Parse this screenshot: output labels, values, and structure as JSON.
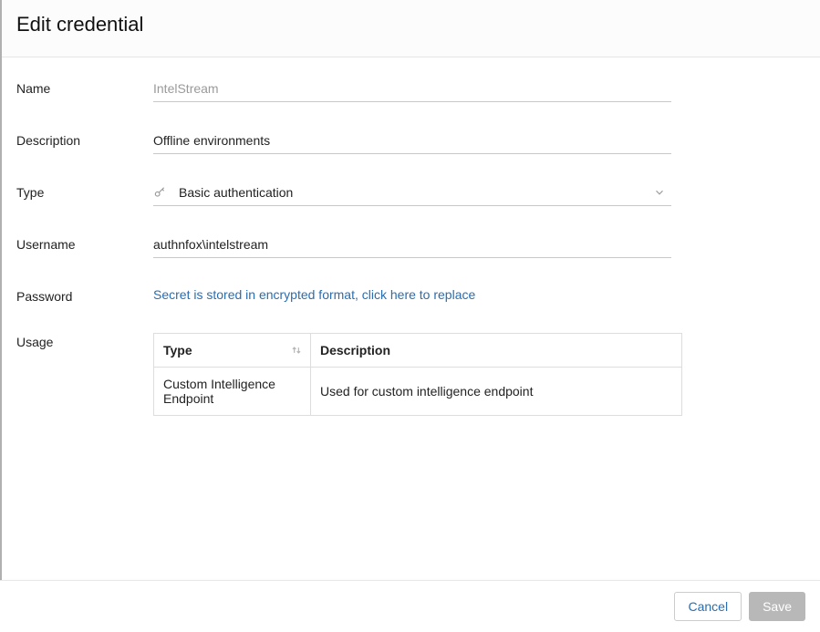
{
  "header": {
    "title": "Edit credential"
  },
  "form": {
    "name": {
      "label": "Name",
      "value": "IntelStream"
    },
    "description": {
      "label": "Description",
      "value": "Offline environments"
    },
    "type": {
      "label": "Type",
      "selected": "Basic authentication"
    },
    "username": {
      "label": "Username",
      "value": "authnfox\\intelstream"
    },
    "password": {
      "label": "Password",
      "link_text": "Secret is stored in encrypted format, click here to replace"
    },
    "usage": {
      "label": "Usage",
      "columns": {
        "type": "Type",
        "description": "Description"
      },
      "rows": [
        {
          "type": "Custom Intelligence Endpoint",
          "description": "Used for custom intelligence endpoint"
        }
      ]
    }
  },
  "footer": {
    "cancel": "Cancel",
    "save": "Save"
  }
}
